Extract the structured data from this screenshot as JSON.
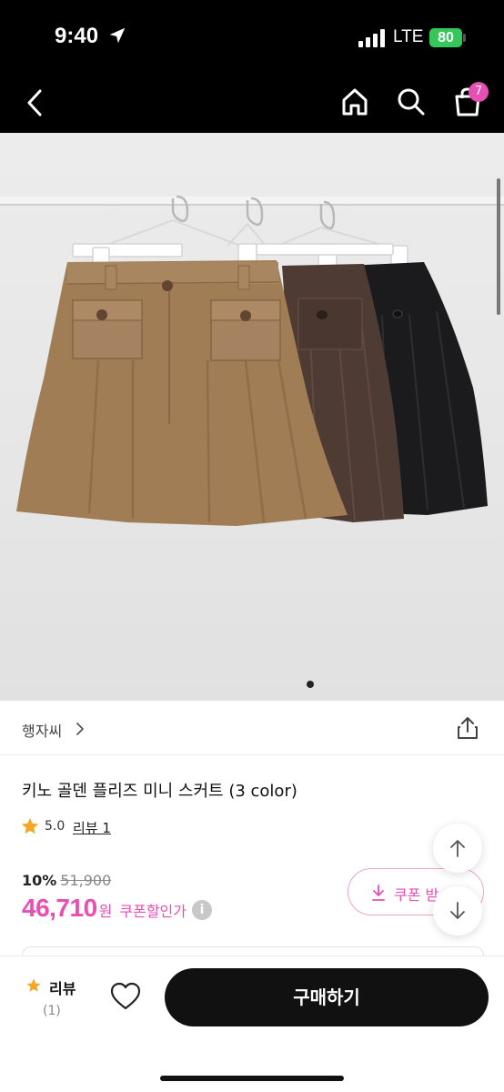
{
  "status_bar": {
    "time": "9:40",
    "network": "LTE",
    "battery": "80",
    "location_icon": "location-arrow-icon",
    "signal_icon": "signal-bars-icon"
  },
  "nav": {
    "back_icon": "chevron-left-icon",
    "home_icon": "home-icon",
    "search_icon": "search-icon",
    "cart_icon": "shopping-bag-icon",
    "cart_count": "7"
  },
  "product_image": {
    "colors": {
      "camel": "#a07d55",
      "brown": "#4e3b33",
      "black": "#1b1b1d"
    },
    "current_page": 1,
    "page_count": 1
  },
  "brand": {
    "name": "행자씨",
    "chevron_icon": "chevron-right-icon",
    "share_icon": "share-icon"
  },
  "product": {
    "title": "키노 골덴 플리즈 미니 스커트 (3 color)",
    "rating": "5.0",
    "review_link": "리뷰 1",
    "discount_rate": "10%",
    "original_price": "51,900",
    "price": "46,710",
    "price_unit": "원",
    "coupon_price_label": "쿠폰할인가",
    "info_icon_glyph": "i"
  },
  "coupon": {
    "label": "쿠폰 받",
    "icon": "download-icon"
  },
  "colors": {
    "accent": "#e84fb3",
    "buy_button": "#111111",
    "star": "#f5a623",
    "battery": "#34c759"
  },
  "bottom_bar": {
    "review_label": "리뷰",
    "review_count": "(1)",
    "wishlist_icon": "heart-icon",
    "buy_label": "구매하기"
  }
}
